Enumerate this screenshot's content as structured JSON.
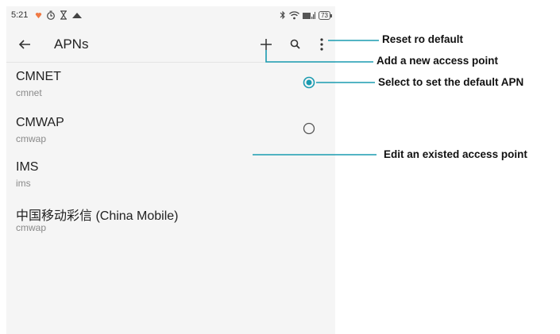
{
  "status_bar": {
    "time": "5:21",
    "battery": "73",
    "icons": [
      "notification-icon",
      "timer-icon",
      "hourglass-icon",
      "cloud-icon",
      "bluetooth-icon",
      "wifi-icon",
      "signal-icon",
      "battery-icon"
    ]
  },
  "toolbar": {
    "title": "APNs",
    "icons": [
      "back-arrow-icon",
      "plus-icon",
      "search-icon",
      "more-vert-icon"
    ]
  },
  "apns": [
    {
      "name": "CMNET",
      "apn": "cmnet",
      "selected": true
    },
    {
      "name": "CMWAP",
      "apn": "cmwap",
      "selected": false
    },
    {
      "name": "IMS",
      "apn": "ims",
      "selected": null
    },
    {
      "name": "中国移动彩信 (China Mobile)",
      "apn": "cmwap",
      "selected": null
    }
  ],
  "annotations": {
    "reset": "Reset ro default",
    "add": "Add a new  access point",
    "select": "Select to set the default APN",
    "edit": "Edit an existed access point"
  },
  "colors": {
    "accent": "#1a9bb0",
    "annotation_line": "#1a9bb0",
    "screen_bg": "#f5f5f5",
    "notification": "#f07a45"
  }
}
